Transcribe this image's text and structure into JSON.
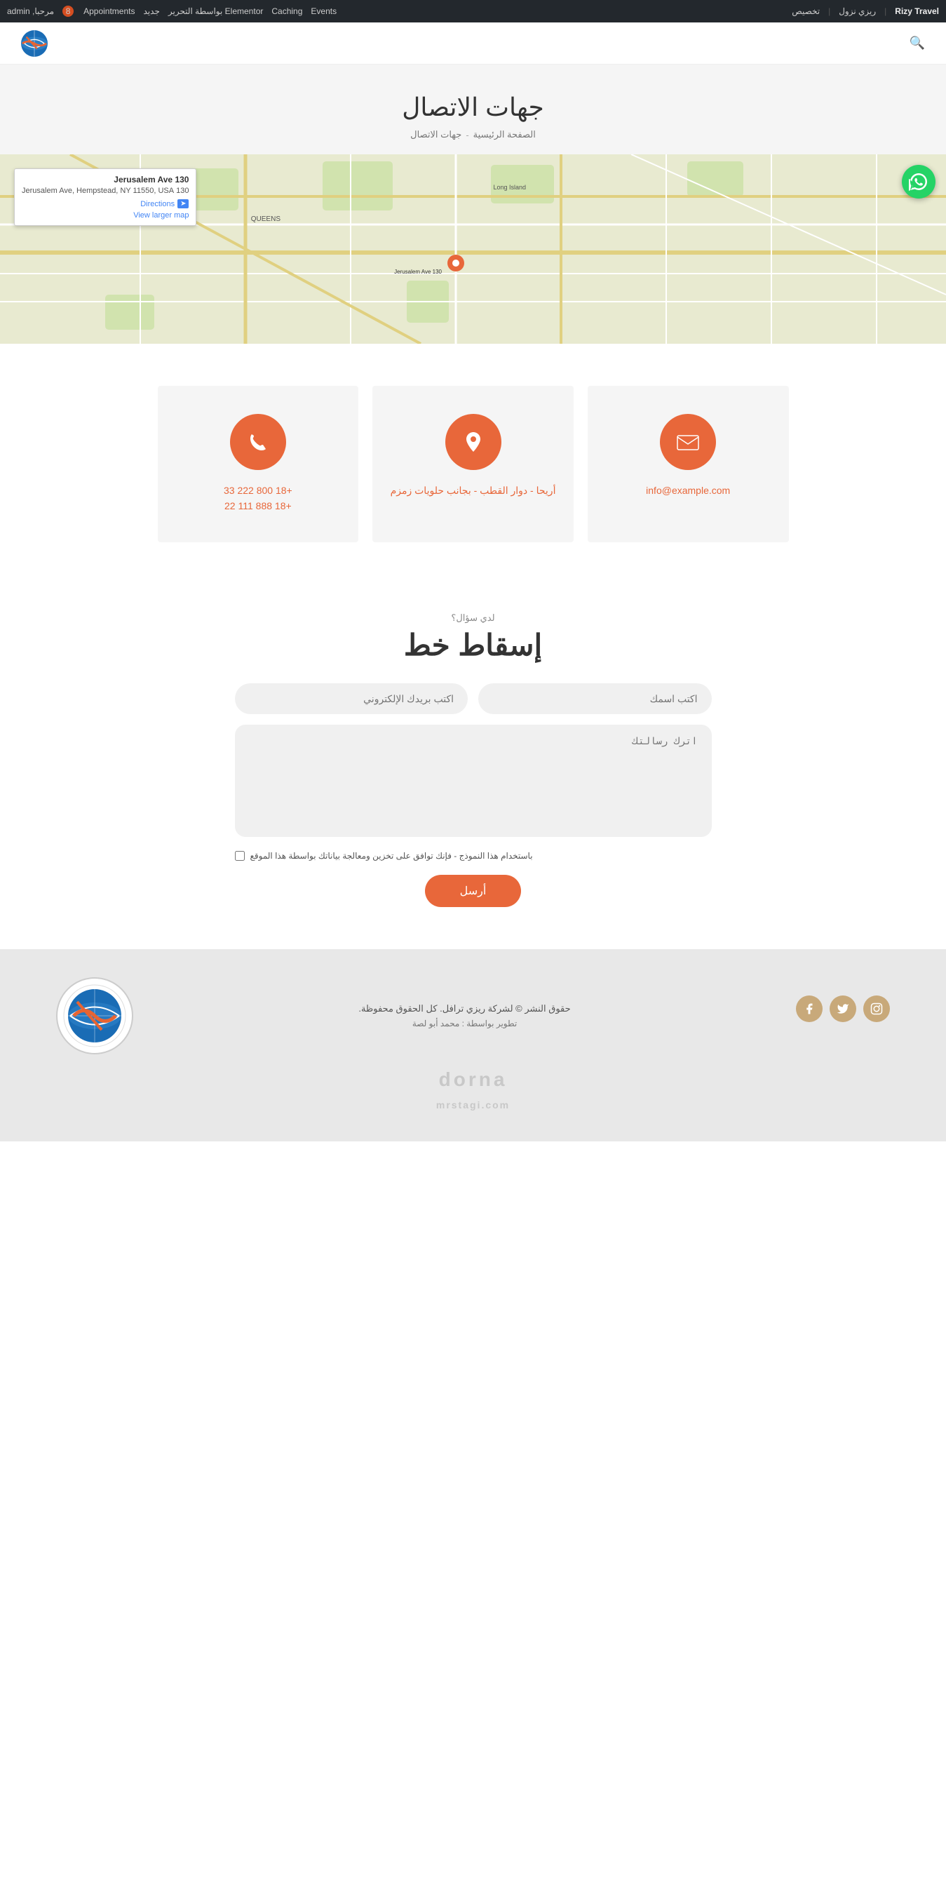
{
  "admin_bar": {
    "site_name": "Rizy Travel",
    "user": "ريزي نزول",
    "customize": "تخصيص",
    "events": "Events",
    "caching": "Caching",
    "elementor": "Elementor بواسطة التحرير",
    "new": "جديد",
    "appointments": "Appointments",
    "comments_count": "8",
    "icon_search": "🔍",
    "admin_label": "مرحبا, admin"
  },
  "header": {
    "logo_alt": "Rizy Travel Logo"
  },
  "page": {
    "title": "جهات الاتصال",
    "breadcrumb_home": "الصفحة الرئيسية",
    "breadcrumb_separator": "-",
    "breadcrumb_current": "جهات الاتصال"
  },
  "map": {
    "popup": {
      "title": "130 Jerusalem Ave",
      "address": "130 Jerusalem Ave, Hempstead, NY 11550, USA",
      "directions_label": "Directions",
      "view_larger": "View larger map"
    },
    "whatsapp_icon": "💬"
  },
  "contact_cards": {
    "email": {
      "icon": "✉",
      "text": "info@example.com"
    },
    "address": {
      "icon": "📍",
      "text": "أريحا - دوار القطب - بجانب حلويات زمزم"
    },
    "phone": {
      "icon": "📞",
      "line1": "+18 800 222 33",
      "line2": "+18 888 111 22"
    }
  },
  "contact_form": {
    "sub_label": "لدي سؤال؟",
    "title": "إسقاط خط",
    "name_placeholder": "اكتب اسمك",
    "email_placeholder": "اكتب بريدك الإلكتروني",
    "message_placeholder": "اترك رسالتك",
    "checkbox_label": "باستخدام هذا النموذج - فإنك توافق على تخزين ومعالجة بياناتك بواسطة هذا الموقع",
    "submit_label": "أرسل"
  },
  "footer": {
    "social": {
      "instagram_icon": "📷",
      "twitter_icon": "🐦",
      "facebook_icon": "f"
    },
    "copyright": "حقوق النشر © لشركة ريزي ترافل. كل الحقوق محفوظة.",
    "credit": "تطوير بواسطة : محمد أبو لصة",
    "watermark": "dorna",
    "watermark_sub": "mrstagi.com"
  }
}
